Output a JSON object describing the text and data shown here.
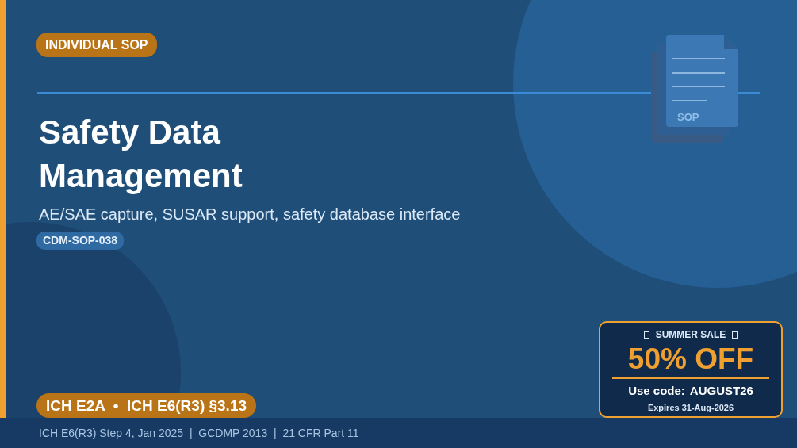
{
  "category_badge": "INDIVIDUAL SOP",
  "title_lines": [
    "Safety Data",
    "Management"
  ],
  "subtitle": "AE/SAE capture, SUSAR support, safety database interface",
  "code_badge": "CDM-SOP-038",
  "document_icon": {
    "label": "SOP"
  },
  "standards_badge": "ICH E2A  •  ICH E6(R3) §3.13",
  "promo": {
    "heading": "SUMMER SALE",
    "discount": "50% OFF",
    "code_label": "Use code:",
    "code": "AUGUST26",
    "expiry": "Expires 31-Aug-2026"
  },
  "footer": "ICH E6(R3) Step 4, Jan 2025  |  GCDMP 2013  |  21 CFR Part 11"
}
